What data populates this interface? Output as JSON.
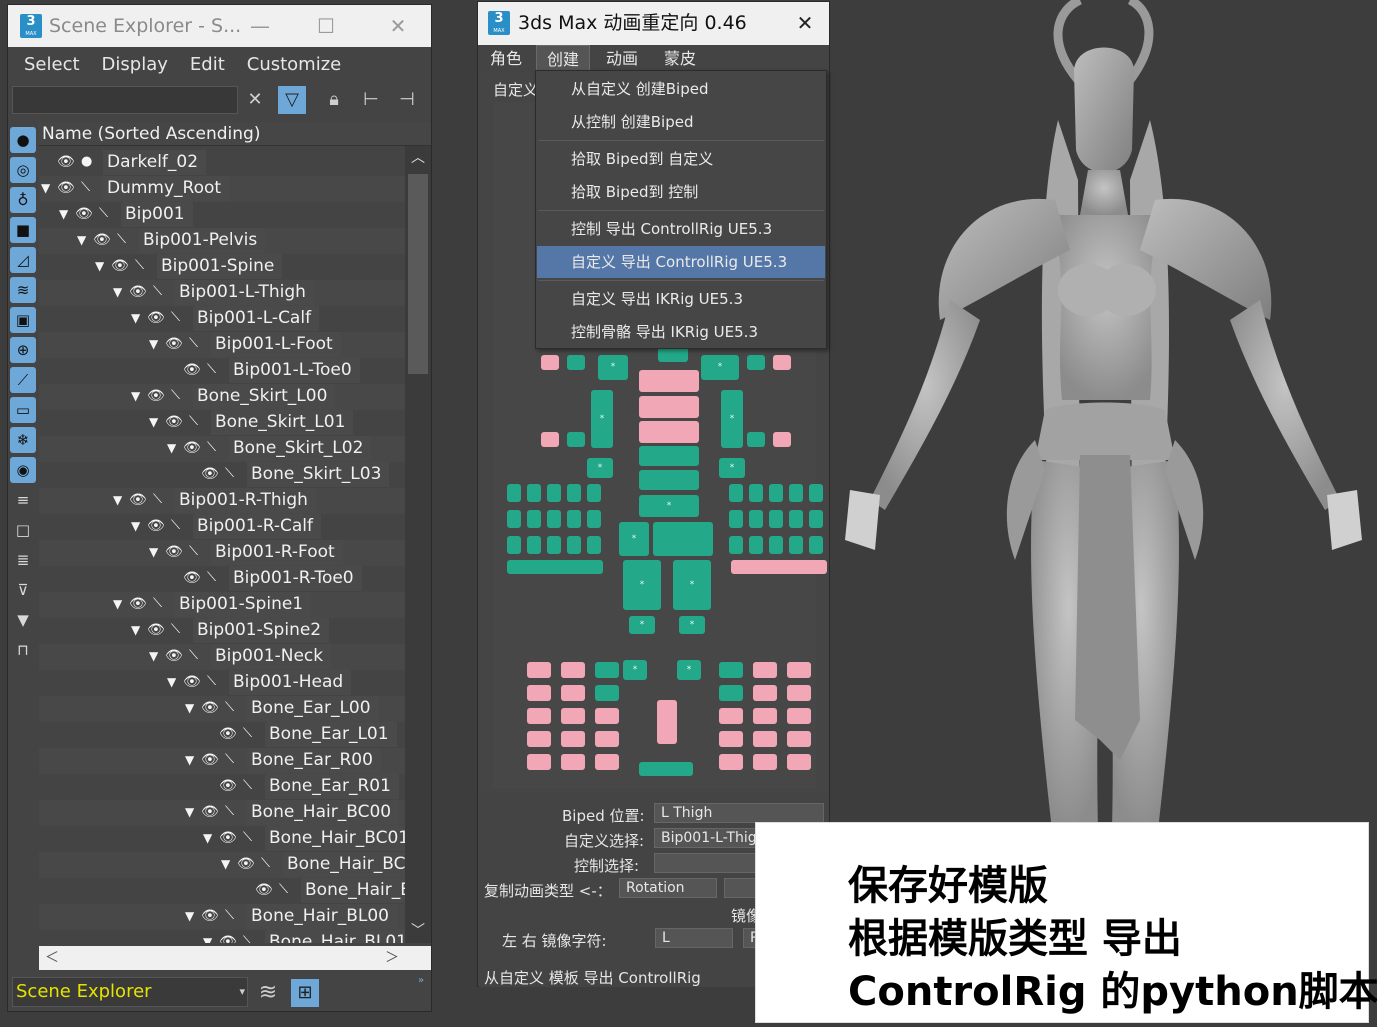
{
  "scene_explorer": {
    "title": "Scene Explorer - S...",
    "logo_number": "3",
    "logo_text": "MAX",
    "menu": [
      "Select",
      "Display",
      "Edit",
      "Customize"
    ],
    "column_header": "Name (Sorted Ascending)",
    "tree": [
      {
        "label": "Darkelf_02",
        "depth": 0,
        "expander": false,
        "type": "geometry"
      },
      {
        "label": "Dummy_Root",
        "depth": 0,
        "expander": true,
        "type": "bone"
      },
      {
        "label": "Bip001",
        "depth": 1,
        "expander": true,
        "type": "bone"
      },
      {
        "label": "Bip001-Pelvis",
        "depth": 2,
        "expander": true,
        "type": "bone"
      },
      {
        "label": "Bip001-Spine",
        "depth": 3,
        "expander": true,
        "type": "bone"
      },
      {
        "label": "Bip001-L-Thigh",
        "depth": 4,
        "expander": true,
        "type": "bone"
      },
      {
        "label": "Bip001-L-Calf",
        "depth": 5,
        "expander": true,
        "type": "bone"
      },
      {
        "label": "Bip001-L-Foot",
        "depth": 6,
        "expander": true,
        "type": "bone"
      },
      {
        "label": "Bip001-L-Toe0",
        "depth": 7,
        "expander": false,
        "type": "bone"
      },
      {
        "label": "Bone_Skirt_L00",
        "depth": 5,
        "expander": true,
        "type": "bone"
      },
      {
        "label": "Bone_Skirt_L01",
        "depth": 6,
        "expander": true,
        "type": "bone"
      },
      {
        "label": "Bone_Skirt_L02",
        "depth": 7,
        "expander": true,
        "type": "bone"
      },
      {
        "label": "Bone_Skirt_L03",
        "depth": 8,
        "expander": false,
        "type": "bone"
      },
      {
        "label": "Bip001-R-Thigh",
        "depth": 4,
        "expander": true,
        "type": "bone"
      },
      {
        "label": "Bip001-R-Calf",
        "depth": 5,
        "expander": true,
        "type": "bone"
      },
      {
        "label": "Bip001-R-Foot",
        "depth": 6,
        "expander": true,
        "type": "bone"
      },
      {
        "label": "Bip001-R-Toe0",
        "depth": 7,
        "expander": false,
        "type": "bone"
      },
      {
        "label": "Bip001-Spine1",
        "depth": 4,
        "expander": true,
        "type": "bone"
      },
      {
        "label": "Bip001-Spine2",
        "depth": 5,
        "expander": true,
        "type": "bone"
      },
      {
        "label": "Bip001-Neck",
        "depth": 6,
        "expander": true,
        "type": "bone"
      },
      {
        "label": "Bip001-Head",
        "depth": 7,
        "expander": true,
        "type": "bone"
      },
      {
        "label": "Bone_Ear_L00",
        "depth": 8,
        "expander": true,
        "type": "bone"
      },
      {
        "label": "Bone_Ear_L01",
        "depth": 9,
        "expander": false,
        "type": "bone"
      },
      {
        "label": "Bone_Ear_R00",
        "depth": 8,
        "expander": true,
        "type": "bone"
      },
      {
        "label": "Bone_Ear_R01",
        "depth": 9,
        "expander": false,
        "type": "bone"
      },
      {
        "label": "Bone_Hair_BC00",
        "depth": 8,
        "expander": true,
        "type": "bone"
      },
      {
        "label": "Bone_Hair_BC01",
        "depth": 9,
        "expander": true,
        "type": "bone"
      },
      {
        "label": "Bone_Hair_BC(",
        "depth": 10,
        "expander": true,
        "type": "bone"
      },
      {
        "label": "Bone_Hair_E",
        "depth": 11,
        "expander": false,
        "type": "bone"
      },
      {
        "label": "Bone_Hair_BL00",
        "depth": 8,
        "expander": true,
        "type": "bone"
      },
      {
        "label": "Bone_Hair_BL01",
        "depth": 9,
        "expander": true,
        "type": "bone"
      }
    ],
    "bottom_combo": "Scene Explorer"
  },
  "retarget": {
    "title": "3ds Max 动画重定向 0.46",
    "logo_number": "3",
    "logo_text": "MAX",
    "menu": [
      "角色",
      "创建",
      "动画",
      "蒙皮"
    ],
    "active_menu": "创建",
    "tab_label": "自定义",
    "dropdown": [
      {
        "label": "从自定义 创建Biped",
        "highlighted": false
      },
      {
        "label": "从控制 创建Biped",
        "highlighted": false
      },
      {
        "label": "拾取 Biped到 自定义",
        "highlighted": false
      },
      {
        "label": "拾取 Biped到 控制",
        "highlighted": false
      },
      {
        "label": "控制 导出 ControllRig UE5.3",
        "highlighted": false
      },
      {
        "label": "自定义 导出 ControllRig UE5.3",
        "highlighted": true
      },
      {
        "label": "自定义 导出 IKRig UE5.3",
        "highlighted": false
      },
      {
        "label": "控制骨骼 导出 IKRig UE5.3",
        "highlighted": false
      }
    ],
    "fields": {
      "biped_pos_label": "Biped 位置:",
      "biped_pos_value": "L Thigh",
      "custom_sel_label": "自定义选择:",
      "custom_sel_value": "Bip001-L-Thig",
      "control_sel_label": "控制选择:",
      "control_sel_value": "",
      "copy_anim_label": "复制动画类型 <-：",
      "copy_anim_value": "Rotation",
      "mirror_partial": "镜像",
      "mirror_char_label": "左 右 镜像字符:",
      "mirror_left": "L",
      "mirror_right": "R",
      "export_label": "从自定义 模板 导出 ControllRig"
    },
    "marker_star": "*",
    "colors": {
      "mapped": "#23a889",
      "unmapped": "#f2a7b6",
      "highlight": "#5577a8"
    }
  },
  "caption": {
    "line1": "保存好模版",
    "line2": "根据模版类型 导出",
    "line3": "ControlRig 的python脚本"
  }
}
